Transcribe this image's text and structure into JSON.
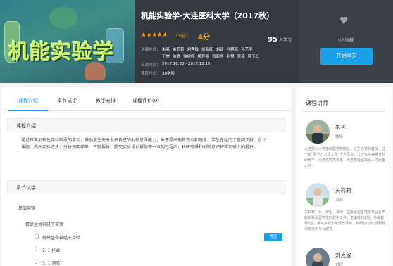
{
  "cover": {
    "title": "机能实验学"
  },
  "course": {
    "title": "机能实验学-大连医科大学（2017秋）",
    "stars": "★★★★★",
    "score_small": "(5分)",
    "score_big": "4分",
    "learners_num": "95",
    "learners_unit": "人学习",
    "teachers_label": "讲课老师：",
    "teachers": [
      "朱亮",
      "关莉莉",
      "刘秀敏",
      "刘丽红",
      "刘琦",
      "孙麒蕊",
      "孙艺平",
      "王崇",
      "徐静",
      "徐婷婷",
      "姚芹丽",
      "张彩华",
      "赵慧",
      "吴琼",
      "贾玉红"
    ],
    "period_label": "上课时间：",
    "period": "2017.10.30 - 2017.12.15",
    "hours_label": "课程时长：",
    "hours": "30学时"
  },
  "actions": {
    "heart_icon": "heart-icon",
    "fav_count": "0人收藏",
    "start_label": "开始学习"
  },
  "tabs": [
    {
      "label": "课程介绍"
    },
    {
      "label": "章节试学"
    },
    {
      "label": "教学安排"
    },
    {
      "label": "课程评价(0)"
    }
  ],
  "intro": {
    "heading": "课程介绍",
    "text": "通过探索创新性实验阶段的学习，鼓励学生充分发挥自己的创新思维能力，敢于提出创新观点和理念。学生在经历了查阅文献、设计课题、提出实验方法、分析预期结果、开题报告、提交实验设计报告等一系列过程后，科研思维和创新意识将得到很大的提升。"
  },
  "chapters": {
    "heading": "章节试学",
    "basic": "基础实验",
    "unit": "蟾蜍坐骨神经干实验",
    "lesson": "蟾蜍坐骨神经干实验",
    "item1": "3. 1  作业",
    "item2": "3. 1  测验",
    "preview_label": "预览"
  },
  "side": {
    "title": "课程讲师",
    "teachers": [
      {
        "name": "朱亮",
        "role": "教授",
        "desc": "大连医科大学基础医学院院长，辽宁省特聘教授，辽宁省“百千万人才工程”千人层次，辽宁省高等教育科研骨干，大连市优秀专家，大连市首届领军人才后备人才。"
      },
      {
        "name": "关莉莉",
        "role": "讲师",
        "desc": "关莉莉，女，博士，讲师。主要承担生理学专业五年制本科及留学生的教学工作，主编教材1部，参编教材5部。参与多项省级教改项目。科研方向为“视网膜功能损伤与代谢性…"
      },
      {
        "name": "刘克敬",
        "role": "讲师"
      }
    ]
  },
  "colors": {
    "accent": "#1aa0e8",
    "star": "#f5a623",
    "header_bg": "#34393f"
  }
}
